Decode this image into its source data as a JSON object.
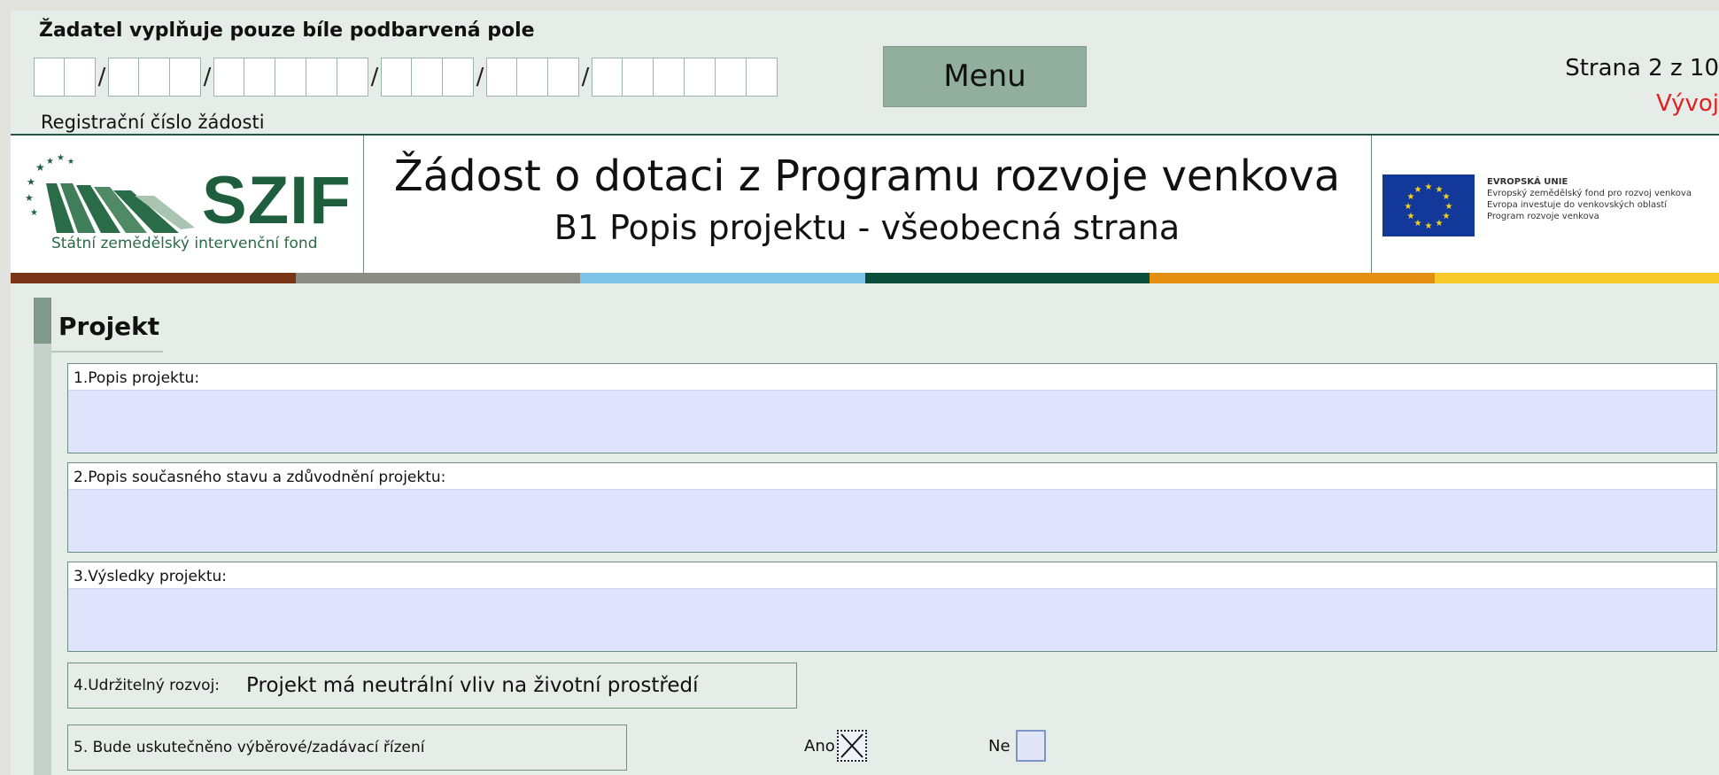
{
  "header": {
    "instruction": "Žadatel vyplňuje pouze bíle podbarvená pole",
    "registration": {
      "label": "Registrační číslo žádosti",
      "groups": [
        2,
        3,
        5,
        3,
        3,
        6
      ],
      "separator": "/"
    },
    "menu_label": "Menu",
    "page_info": "Strana 2 z 10",
    "status": "Vývoj"
  },
  "title_band": {
    "logo_name": "SZIF",
    "logo_subtitle": "Státní zemědělský intervenční fond",
    "title": "Žádost o dotaci z Programu rozvoje venkova",
    "subtitle": "B1 Popis projektu - všeobecná strana",
    "eu": {
      "heading": "EVROPSKÁ UNIE",
      "line1": "Evropský zemědělský fond pro rozvoj venkova",
      "line2": "Evropa investuje do venkovských oblastí",
      "line3": "Program rozvoje venkova"
    }
  },
  "color_strip": [
    "#7a3418",
    "#8c8c86",
    "#7cc3e7",
    "#0c4d3a",
    "#e58f12",
    "#f8c92a"
  ],
  "section": {
    "title": "Projekt",
    "fields": [
      {
        "label": "1.Popis projektu:",
        "value": ""
      },
      {
        "label": "2.Popis současného stavu a zdůvodnění projektu:",
        "value": ""
      },
      {
        "label": "3.Výsledky projektu:",
        "value": ""
      }
    ],
    "sustainable": {
      "label": "4.Udržitelný rozvoj:",
      "value": "Projekt má neutrální vliv na životní prostředí"
    },
    "tender": {
      "label": "5. Bude uskutečněno výběrové/zadávací řízení",
      "yes_label": "Ano",
      "no_label": "Ne",
      "yes_checked": true,
      "no_checked": false
    }
  },
  "colors": {
    "page_bg": "#e6ece8",
    "input_fill": "#dfe4fc",
    "menu_bg": "#92ae9d",
    "status_red": "#e12020",
    "brand_green": "#1f5e3d"
  }
}
